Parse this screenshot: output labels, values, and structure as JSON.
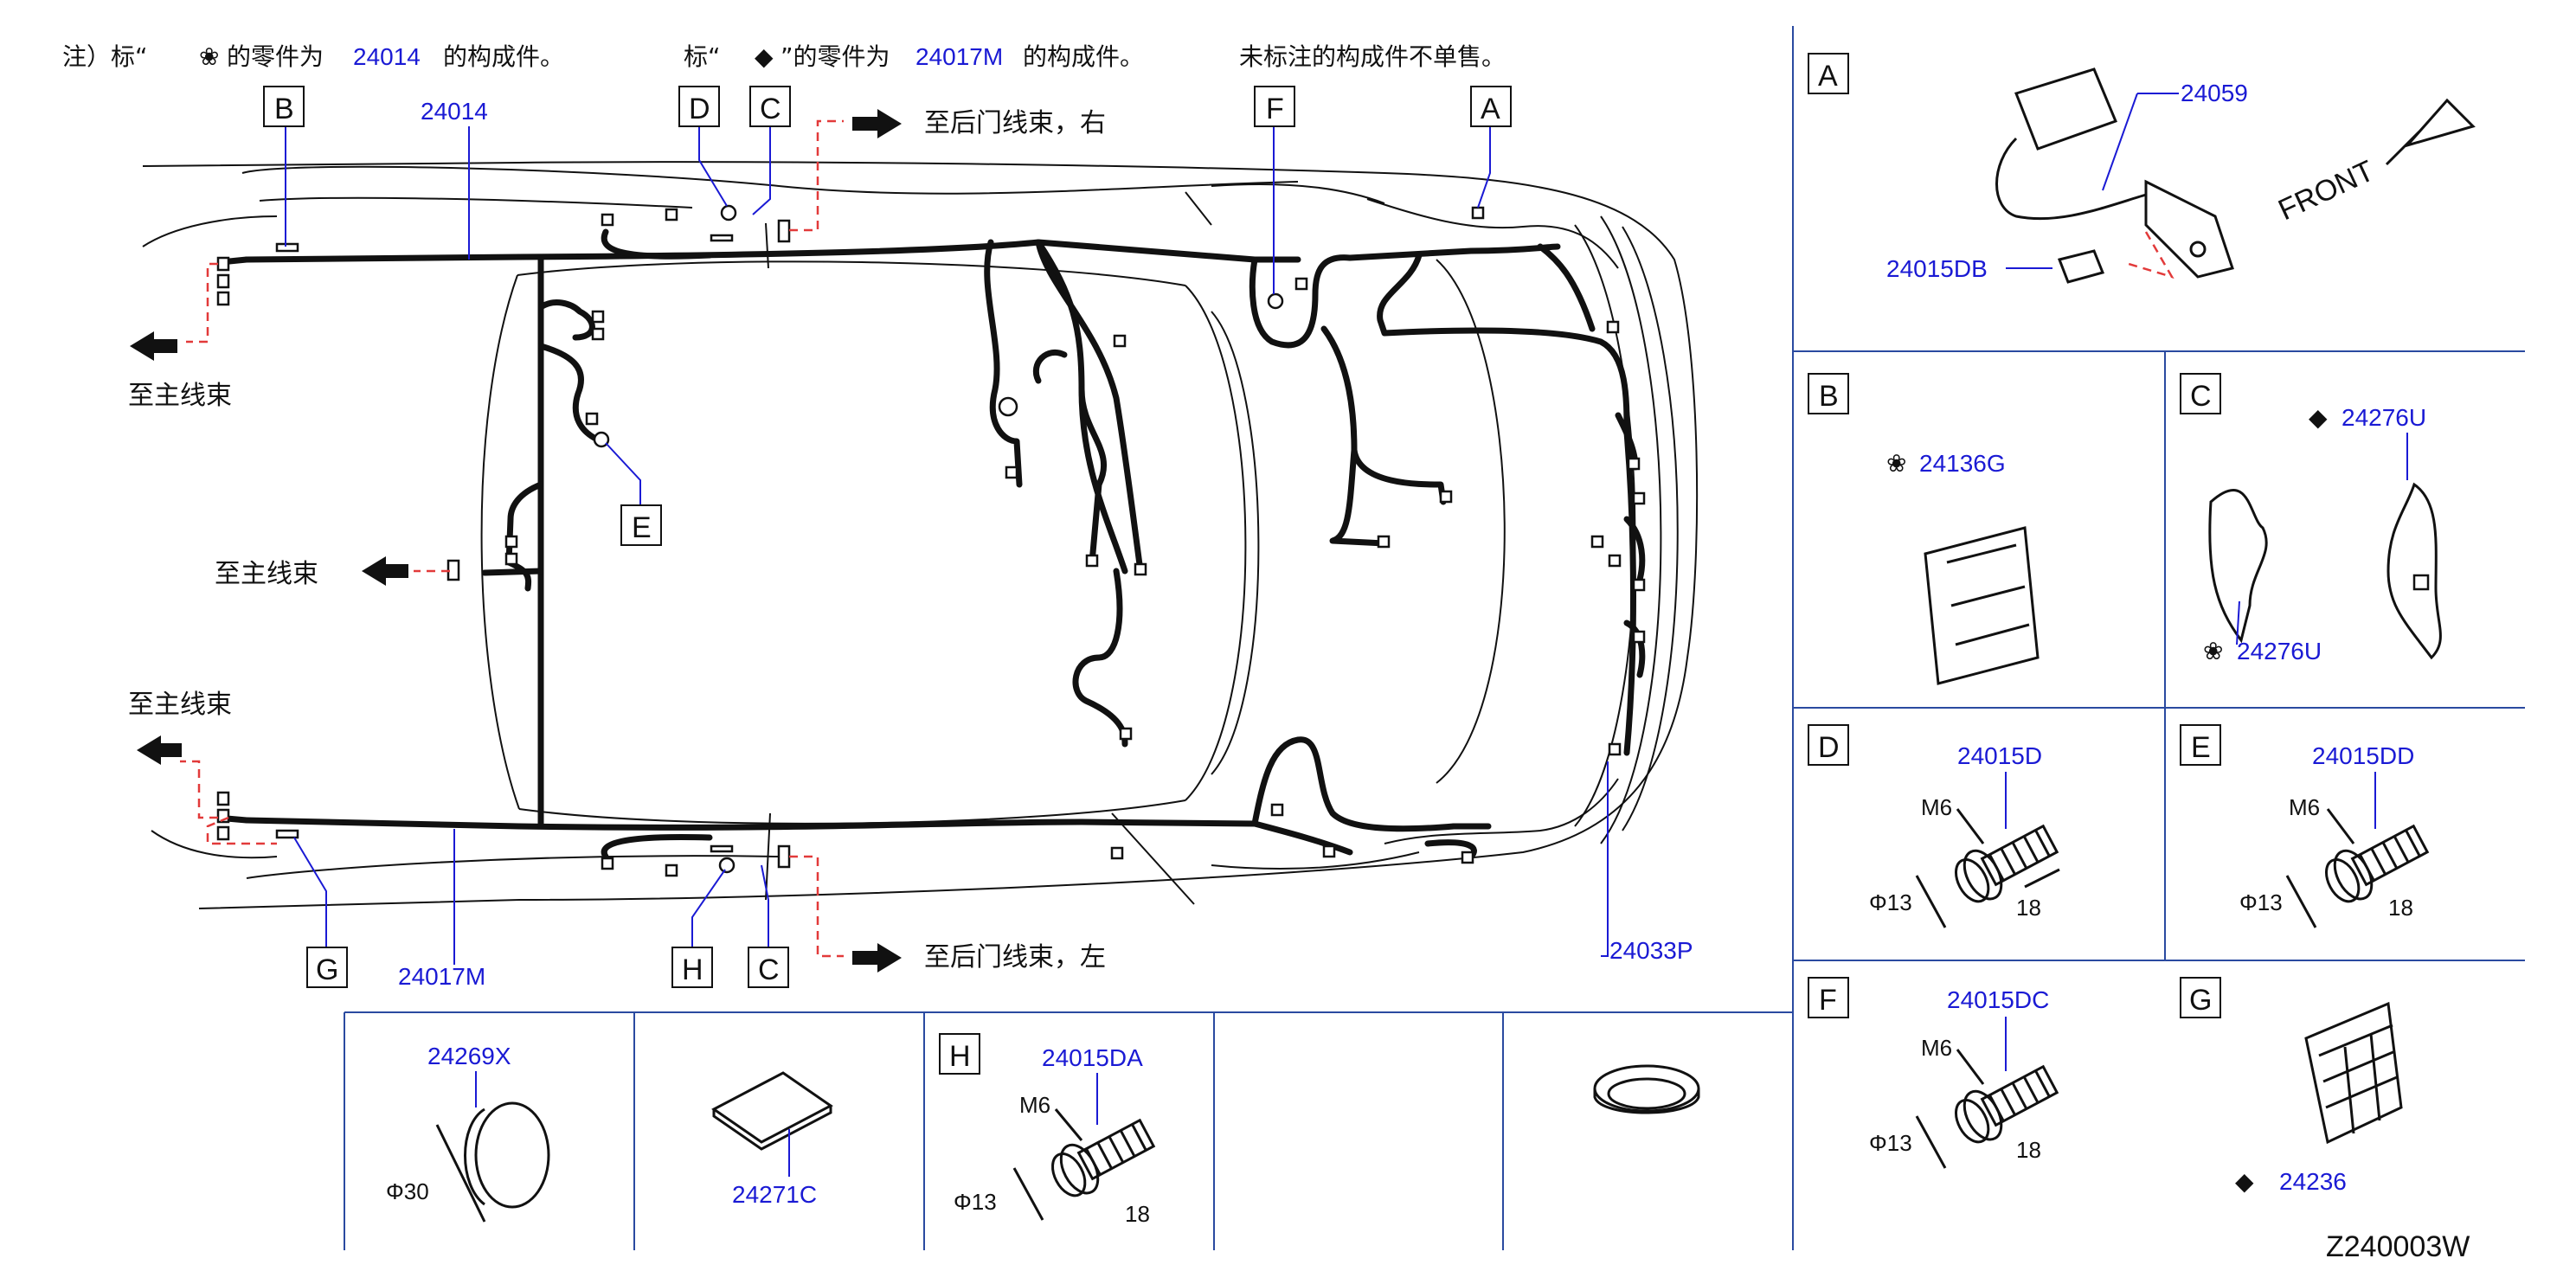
{
  "notes": {
    "note1_prefix": "注）标“",
    "note1_mid": "的零件为",
    "note1_part": "24014",
    "note1_suffix": "的构成件。",
    "note2_prefix": "标“",
    "note2_mid": "”的零件为",
    "note2_part": "24017M",
    "note2_suffix": "的构成件。",
    "note3": "未标注的构成件不单售。"
  },
  "main": {
    "callouts": [
      "B",
      "D",
      "C",
      "F",
      "A",
      "E",
      "G",
      "H",
      "C"
    ],
    "part_top_left": "24014",
    "part_bottom_left": "24017M",
    "part_right": "24033P",
    "to_rear_door_right": "至后门线束，右",
    "to_rear_door_left": "至后门线束，左",
    "to_main_1": "至主线束",
    "to_main_2": "至主线束",
    "to_main_3": "至主线束"
  },
  "detail_A": {
    "label": "A",
    "part1": "24059",
    "part2": "24015DB",
    "front": "FRONT"
  },
  "detail_B": {
    "label": "B",
    "part": "24136G"
  },
  "detail_C": {
    "label": "C",
    "part_top": "24276U",
    "part_bottom": "24276U"
  },
  "detail_D": {
    "label": "D",
    "part": "24015D",
    "thread": "M6",
    "dia": "Φ13",
    "len": "18"
  },
  "detail_E": {
    "label": "E",
    "part": "24015DD",
    "thread": "M6",
    "dia": "Φ13",
    "len": "18"
  },
  "detail_F": {
    "label": "F",
    "part": "24015DC",
    "thread": "M6",
    "dia": "Φ13",
    "len": "18"
  },
  "detail_G": {
    "label": "G",
    "part": "24236"
  },
  "bottom": {
    "cap_part": "24269X",
    "cap_dia": "Φ30",
    "pad_part": "24271C",
    "H_label": "H",
    "H_part": "24015DA",
    "H_thread": "M6",
    "H_dia": "Φ13",
    "H_len": "18"
  },
  "figure_code": "Z240003W",
  "colors": {
    "part_number": "#1a1ad4",
    "leader_dashed": "#e23a3a",
    "panel_rule": "#2a4aa0"
  }
}
